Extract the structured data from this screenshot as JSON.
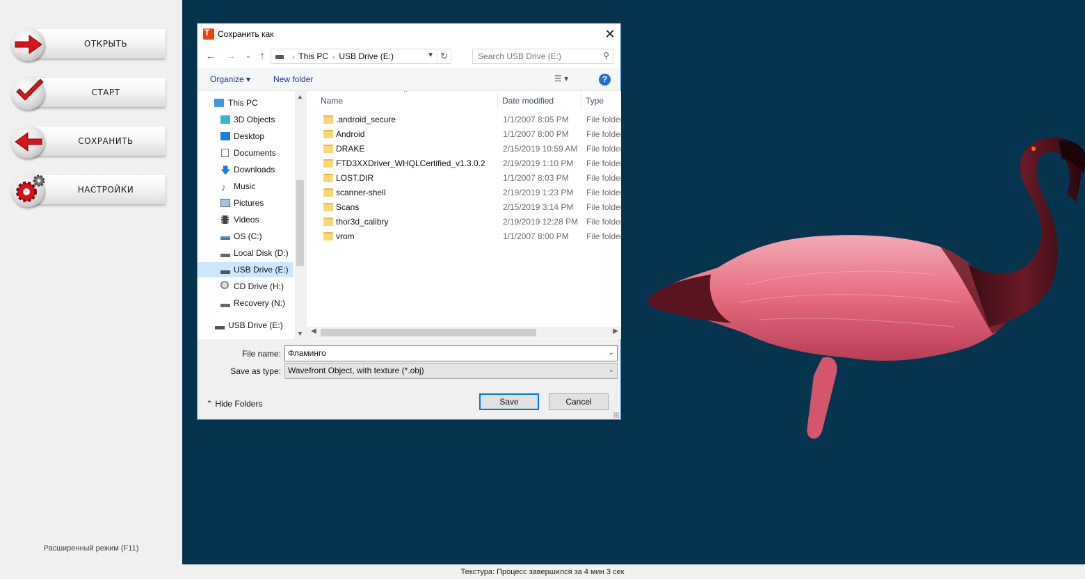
{
  "left_panel": {
    "buttons": [
      {
        "label": "ОТКРЫТЬ",
        "icon": "red-arrow-right-icon"
      },
      {
        "label": "СТАРТ",
        "icon": "red-checkmark-icon"
      },
      {
        "label": "СОХРАНИТЬ",
        "icon": "red-arrow-left-icon"
      },
      {
        "label": "НАСТРОЙКИ",
        "icon": "gears-icon"
      }
    ],
    "extended_mode": "Расширенный режим (F11)"
  },
  "status_bar": {
    "text": "Текстура: Процесс завершился за 4 мин 3 сек"
  },
  "dialog": {
    "title": "Сохранить как",
    "address": {
      "crumbs": [
        "This PC",
        "USB Drive (E:)"
      ]
    },
    "search": {
      "placeholder": "Search USB Drive (E:)"
    },
    "toolbar": {
      "organize": "Organize ▾",
      "new_folder": "New folder",
      "help": "?"
    },
    "nav": [
      {
        "label": "This PC",
        "icon": "computer-icon",
        "level": 0
      },
      {
        "label": "3D Objects",
        "icon": "cube-icon",
        "level": 1
      },
      {
        "label": "Desktop",
        "icon": "desktop-icon",
        "level": 1
      },
      {
        "label": "Documents",
        "icon": "document-icon",
        "level": 1
      },
      {
        "label": "Downloads",
        "icon": "download-arrow-icon",
        "level": 1
      },
      {
        "label": "Music",
        "icon": "music-note-icon",
        "level": 1
      },
      {
        "label": "Pictures",
        "icon": "picture-icon",
        "level": 1
      },
      {
        "label": "Videos",
        "icon": "film-icon",
        "level": 1
      },
      {
        "label": "OS (C:)",
        "icon": "windows-drive-icon",
        "level": 1
      },
      {
        "label": "Local Disk (D:)",
        "icon": "drive-icon",
        "level": 1
      },
      {
        "label": "USB Drive (E:)",
        "icon": "usb-drive-icon",
        "level": 1,
        "selected": true
      },
      {
        "label": "CD Drive (H:)",
        "icon": "cd-drive-icon",
        "level": 1
      },
      {
        "label": "Recovery (N:)",
        "icon": "drive-icon",
        "level": 1
      },
      {
        "label": "USB Drive (E:)",
        "icon": "usb-drive-icon",
        "level": 0
      }
    ],
    "columns": {
      "name": "Name",
      "date": "Date modified",
      "type": "Type"
    },
    "files": [
      {
        "name": ".android_secure",
        "date": "1/1/2007 8:05 PM",
        "type": "File folder"
      },
      {
        "name": "Android",
        "date": "1/1/2007 8:00 PM",
        "type": "File folder"
      },
      {
        "name": "DRAKE",
        "date": "2/15/2019 10:59 AM",
        "type": "File folder"
      },
      {
        "name": "FTD3XXDriver_WHQLCertified_v1.3.0.2",
        "date": "2/19/2019 1:10 PM",
        "type": "File folder"
      },
      {
        "name": "LOST.DIR",
        "date": "1/1/2007 8:03 PM",
        "type": "File folder"
      },
      {
        "name": "scanner-shell",
        "date": "2/19/2019 1:23 PM",
        "type": "File folder"
      },
      {
        "name": "Scans",
        "date": "2/15/2019 3:14 PM",
        "type": "File folder"
      },
      {
        "name": "thor3d_calibry",
        "date": "2/19/2019 12:28 PM",
        "type": "File folder"
      },
      {
        "name": "vrom",
        "date": "1/1/2007 8:00 PM",
        "type": "File folder"
      }
    ],
    "file_name_label": "File name:",
    "file_name_value": "Фламинго",
    "save_type_label": "Save as type:",
    "save_type_value": "Wavefront Object, with texture (*.obj)",
    "hide_folders": "Hide Folders",
    "save_label": "Save",
    "cancel_label": "Cancel"
  },
  "colors": {
    "viewport_bg": "#05344f",
    "flamingo_body": "#e0687e",
    "flamingo_neck": "#5a1420",
    "accent": "#0078d7"
  }
}
